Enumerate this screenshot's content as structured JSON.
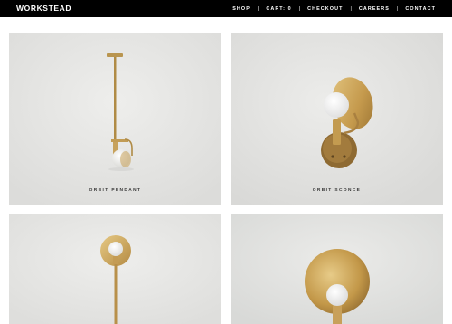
{
  "header": {
    "logo": "WORKSTEAD",
    "nav": [
      {
        "label": "SHOP"
      },
      {
        "label": "CART: 0"
      },
      {
        "label": "CHECKOUT"
      },
      {
        "label": "CAREERS"
      },
      {
        "label": "CONTACT"
      }
    ],
    "separator": "|"
  },
  "products": [
    {
      "name": "ORBIT PENDANT"
    },
    {
      "name": "ORBIT SCONCE"
    },
    {
      "name": ""
    },
    {
      "name": ""
    }
  ],
  "colors": {
    "topbar": "#000000",
    "tile_background": "#e6e6e4",
    "brass": "#c9a25b",
    "bulb": "#f7f7f5"
  }
}
